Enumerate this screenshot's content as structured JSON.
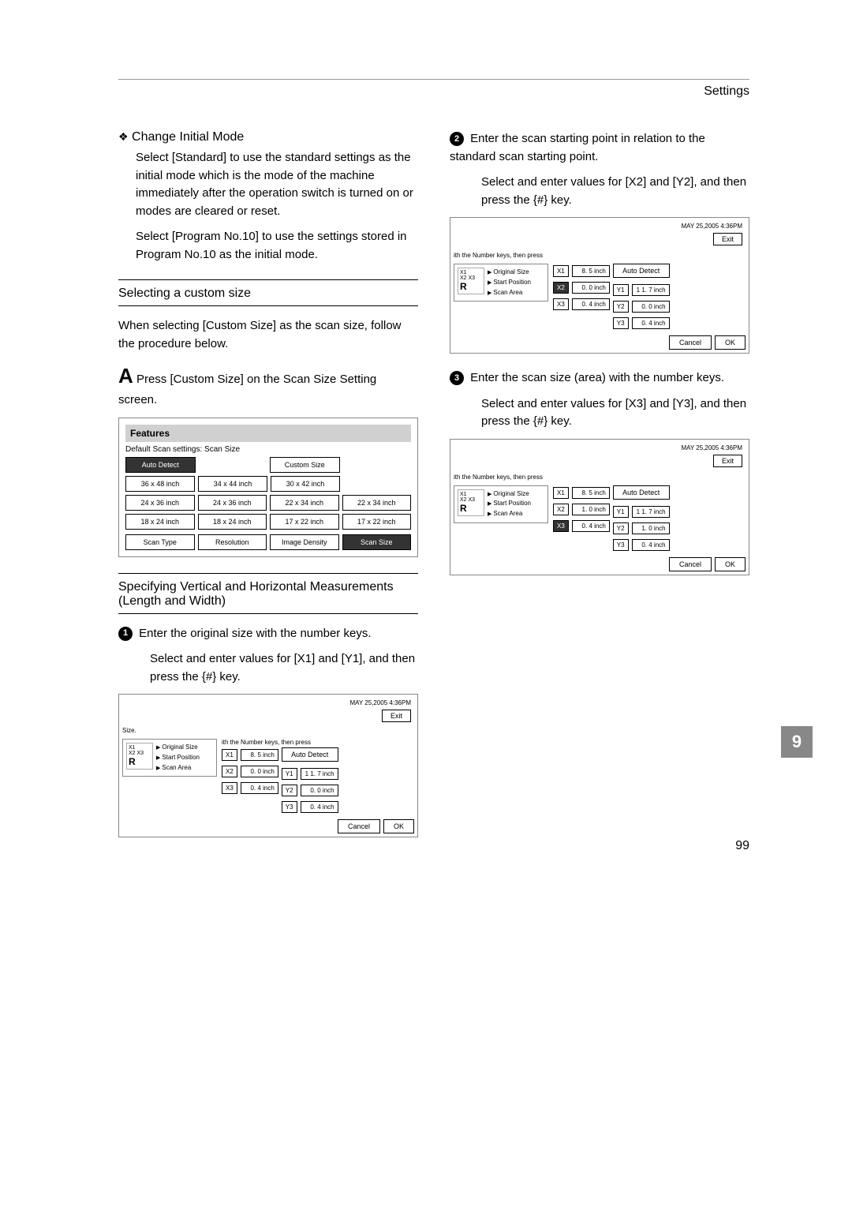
{
  "header": {
    "section": "Settings"
  },
  "left": {
    "change_initial_mode": {
      "title": "Change Initial Mode",
      "p1": "Select [Standard] to use the standard settings as the initial mode which is the mode of the machine immediately after the operation switch is turned on or modes are cleared or reset.",
      "p2": "Select [Program No.10] to use the settings stored in Program No.10 as the initial mode."
    },
    "custom_size": {
      "title": "Selecting a custom size",
      "intro": "When selecting [Custom Size] as the scan size, follow the procedure below.",
      "stepA": "Press [Custom Size] on the Scan Size Setting screen."
    },
    "features_panel": {
      "title": "Features",
      "subtitle": "Default Scan settings: Scan Size",
      "row1": [
        "Auto Detect",
        "",
        "Custom Size",
        ""
      ],
      "row2": [
        "36 x 48 inch",
        "34 x 44 inch",
        "30 x 42 inch",
        ""
      ],
      "row3": [
        "24 x 36 inch",
        "24 x 36 inch",
        "22 x 34 inch",
        "22 x 34 inch"
      ],
      "row4": [
        "18 x 24 inch",
        "18 x 24 inch",
        "17 x 22 inch",
        "17 x 22 inch"
      ],
      "tabs": [
        "Scan Type",
        "Resolution",
        "Image Density",
        "Scan Size"
      ]
    },
    "spec_title": "Specifying Vertical and Horizontal Measurements (Length and Width)",
    "step1": {
      "text": "Enter the original size with the number keys.",
      "sub": "Select and enter values for [X1] and [Y1], and then press the {#} key."
    },
    "scan1": {
      "date": "MAY   25,2005   4:36PM",
      "exit": "Exit",
      "hint": "ith the Number keys, then press",
      "size_word": "Size.",
      "diag_top": "X1",
      "diag_side": "X2  X3",
      "labels": {
        "orig": "Original Size",
        "start": "Start Position",
        "area": "Scan Area"
      },
      "auto": "Auto Detect",
      "x": [
        {
          "l": "X1",
          "v": "8. 5 inch"
        },
        {
          "l": "X2",
          "v": "0. 0 inch"
        },
        {
          "l": "X3",
          "v": "0. 4 inch"
        }
      ],
      "y": [
        {
          "l": "Y1",
          "v": "1 1. 7 inch"
        },
        {
          "l": "Y2",
          "v": "0. 0 inch"
        },
        {
          "l": "Y3",
          "v": "0. 4 inch"
        }
      ],
      "footer": [
        "Cancel",
        "OK"
      ]
    }
  },
  "right": {
    "step2": {
      "text": "Enter the scan starting point in relation to the standard scan starting point.",
      "sub": "Select and enter values for [X2] and [Y2], and then press the {#} key."
    },
    "scan2": {
      "date": "MAY   25,2005   4:36PM",
      "exit": "Exit",
      "hint": "ith the Number keys, then press",
      "diag_top": "X1",
      "diag_side": "X2  X3",
      "labels": {
        "orig": "Original Size",
        "start": "Start Position",
        "area": "Scan Area"
      },
      "auto": "Auto Detect",
      "x": [
        {
          "l": "X1",
          "v": "8. 5 inch"
        },
        {
          "l": "X2",
          "v": "0. 0 inch",
          "hl": true
        },
        {
          "l": "X3",
          "v": "0. 4 inch"
        }
      ],
      "y": [
        {
          "l": "Y1",
          "v": "1 1. 7 inch"
        },
        {
          "l": "Y2",
          "v": "0. 0 inch"
        },
        {
          "l": "Y3",
          "v": "0. 4 inch"
        }
      ],
      "footer": [
        "Cancel",
        "OK"
      ]
    },
    "step3": {
      "text": "Enter the scan size (area) with the number keys.",
      "sub": "Select and enter values for [X3] and [Y3], and then press the {#} key."
    },
    "scan3": {
      "date": "MAY   25,2005   4:36PM",
      "exit": "Exit",
      "hint": "ith the Number keys, then press",
      "diag_top": "X1",
      "diag_side": "X2  X3",
      "labels": {
        "orig": "Original Size",
        "start": "Start Position",
        "area": "Scan Area"
      },
      "auto": "Auto Detect",
      "x": [
        {
          "l": "X1",
          "v": "8. 5 inch"
        },
        {
          "l": "X2",
          "v": "1. 0 inch"
        },
        {
          "l": "X3",
          "v": "0. 4 inch",
          "hl": true
        }
      ],
      "y": [
        {
          "l": "Y1",
          "v": "1 1. 7 inch"
        },
        {
          "l": "Y2",
          "v": "1. 0 inch"
        },
        {
          "l": "Y3",
          "v": "0. 4 inch"
        }
      ],
      "footer": [
        "Cancel",
        "OK"
      ]
    }
  },
  "side_tab": "9",
  "page_num": "99"
}
